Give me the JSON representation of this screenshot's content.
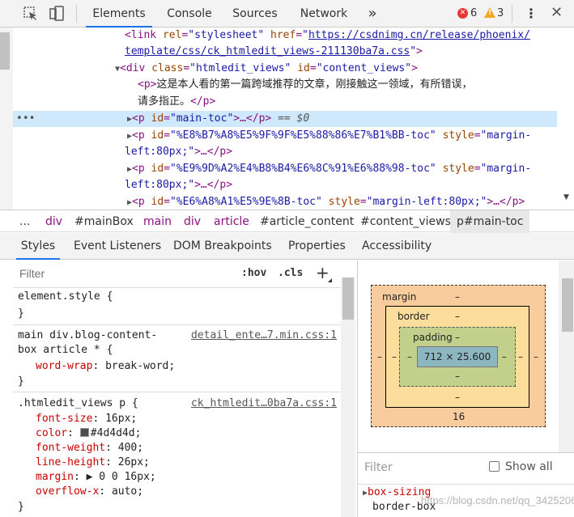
{
  "toolbar": {
    "tabs": [
      "Elements",
      "Console",
      "Sources",
      "Network"
    ],
    "more": "»",
    "errors": "6",
    "warnings": "3",
    "menu": "⋮",
    "close": "✕"
  },
  "dom": {
    "line1": {
      "open": "<link ",
      "a1": "rel",
      "v1": "\"stylesheet\"",
      "a2": "href",
      "v2": "\"",
      "url1": "https://csdnimg.cn/release/phoenix/",
      "url2": "template/css/ck_htmledit_views-211130ba7a.css",
      "close": "\">"
    },
    "line2": {
      "open": "<div ",
      "a1": "class",
      "v1": "\"htmledit_views\"",
      "a2": "id",
      "v2": "\"content_views\"",
      "close": ">"
    },
    "line3": {
      "open": "<p>",
      "text1": "这是本人看的第一篇跨域推荐的文章，刚接触这一领域，有所错误，",
      "text2": "请多指正。",
      "close": "</p>"
    },
    "line4": {
      "dots": "•••",
      "open": "<p ",
      "a1": "id",
      "v1": "\"main-toc\"",
      "mid": ">…</p>",
      "eq": " == $0"
    },
    "line5": {
      "open": "<p ",
      "a1": "id",
      "v1": "\"%E8%B7%A8%E5%9F%9F%E5%88%86%E7%B1%BB-toc\"",
      "a2": "style",
      "v2": "\"margin-",
      "v2b": "left:80px;\"",
      "close": ">…</p>"
    },
    "line6": {
      "open": "<p ",
      "a1": "id",
      "v1": "\"%E9%9D%A2%E4%B8%B4%E6%8C%91%E6%88%98-toc\"",
      "a2": "style",
      "v2": "\"margin-",
      "v2b": "left:80px;\"",
      "close": ">…</p>"
    },
    "line7": {
      "open": "<p ",
      "a1": "id",
      "v1": "\"%E6%A8%A1%E5%9E%8B-toc\"",
      "a2": "style",
      "v2": "\"margin-left:80px;\"",
      "close": ">…</p>"
    }
  },
  "breadcrumbs": [
    "...",
    "div",
    "#mainBox",
    "main",
    "div",
    "article",
    "#article_content",
    "#content_views",
    "p#main-toc"
  ],
  "subtabs": [
    "Styles",
    "Event Listeners",
    "DOM Breakpoints",
    "Properties",
    "Accessibility"
  ],
  "styles": {
    "filter_placeholder": "Filter",
    "hov": ":hov",
    "cls": ".cls",
    "plus": "+",
    "rule1": {
      "selector": "element.style {",
      "close": "}"
    },
    "rule2": {
      "sel1": "main div.blog-content-",
      "sel2": "box article * {",
      "source": "detail_ente…7.min.css:1",
      "prop": "word-wrap",
      "val": "break-word;",
      "close": "}"
    },
    "rule3": {
      "selector": ".htmledit_views p {",
      "source": "ck_htmledit…0ba7a.css:1",
      "props": [
        {
          "name": "font-size",
          "value": "16px;"
        },
        {
          "name": "color",
          "value": "#4d4d4d;"
        },
        {
          "name": "font-weight",
          "value": "400;"
        },
        {
          "name": "line-height",
          "value": "26px;"
        },
        {
          "name": "margin",
          "value": "▶ 0 0 16px;"
        },
        {
          "name": "overflow-x",
          "value": "auto;"
        }
      ],
      "close": "}"
    }
  },
  "boxmodel": {
    "margin_label": "margin",
    "border_label": "border",
    "padding_label": "padding",
    "dash": "–",
    "content": "712 × 25.600",
    "margin_bottom": "16"
  },
  "computed": {
    "filter_placeholder": "Filter",
    "show_all": "Show all",
    "prop": "box-sizing",
    "value": "border-box"
  },
  "watermark": "https://blog.csdn.net/qq_34252068",
  "colors": {
    "accent": "#1a73e8",
    "tag": "#881280",
    "attr": "#994500",
    "value": "#1a1aa6",
    "prop": "#c80000"
  }
}
